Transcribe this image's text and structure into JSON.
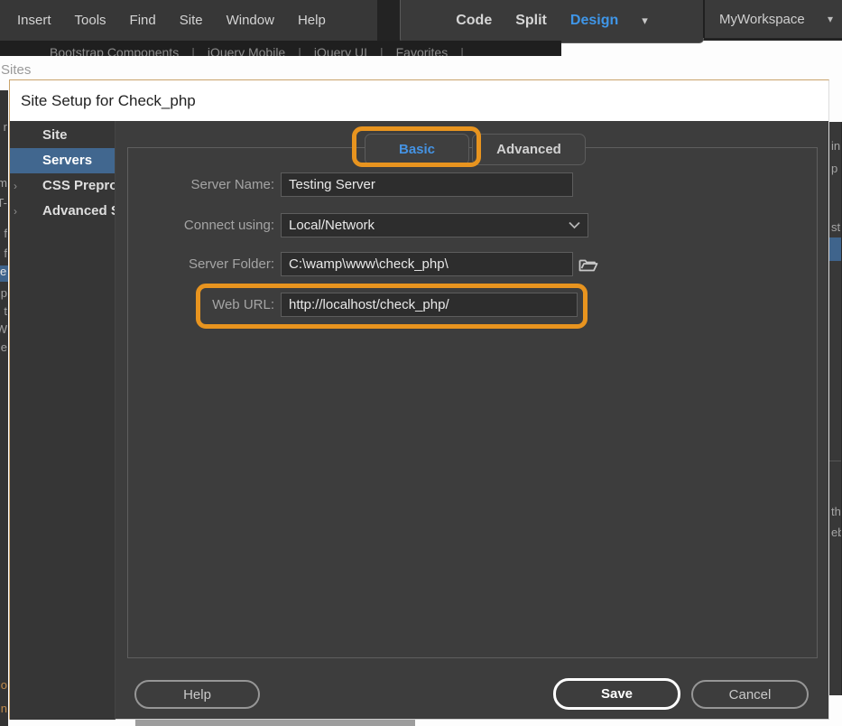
{
  "app": {
    "menu_bar": [
      "Insert",
      "Tools",
      "Find",
      "Site",
      "Window",
      "Help"
    ],
    "view_switcher": {
      "code": "Code",
      "split": "Split",
      "design": "Design",
      "caret": "▾"
    },
    "workspace": {
      "label": "MyWorkspace",
      "caret": "▾"
    },
    "background_tabs": [
      "Bootstrap Components",
      "jQuery Mobile",
      "jQuery UI",
      "Favorites"
    ],
    "tab_separator": "|",
    "sites_label": "Sites",
    "left_edge_fragments": [
      "r",
      "m",
      "T-",
      "f",
      "f",
      "e",
      "p",
      "t",
      "W",
      "e",
      "o",
      "n"
    ],
    "right_edge_fragments": [
      "in",
      "p",
      "st",
      "th",
      "eb"
    ]
  },
  "dialog": {
    "title": "Site Setup for Check_php",
    "sidebar": {
      "items": [
        {
          "label": "Site",
          "selected": false,
          "chevron": ""
        },
        {
          "label": "Servers",
          "selected": true,
          "chevron": ""
        },
        {
          "label": "CSS Preprocessors",
          "selected": false,
          "chevron": "›"
        },
        {
          "label": "Advanced Settings",
          "selected": false,
          "chevron": "›"
        }
      ]
    },
    "tabs": {
      "basic": "Basic",
      "advanced": "Advanced"
    },
    "form": {
      "server_name_label": "Server Name:",
      "server_name_value": "Testing Server",
      "connect_using_label": "Connect using:",
      "connect_using_value": "Local/Network",
      "server_folder_label": "Server Folder:",
      "server_folder_value": "C:\\wamp\\www\\check_php\\",
      "web_url_label": "Web URL:",
      "web_url_value": "http://localhost/check_php/"
    },
    "buttons": {
      "help": "Help",
      "save": "Save",
      "cancel": "Cancel"
    }
  },
  "colors": {
    "annotation": "#E8941F",
    "selection_blue": "#41678F",
    "design_blue": "#3F96E8"
  }
}
